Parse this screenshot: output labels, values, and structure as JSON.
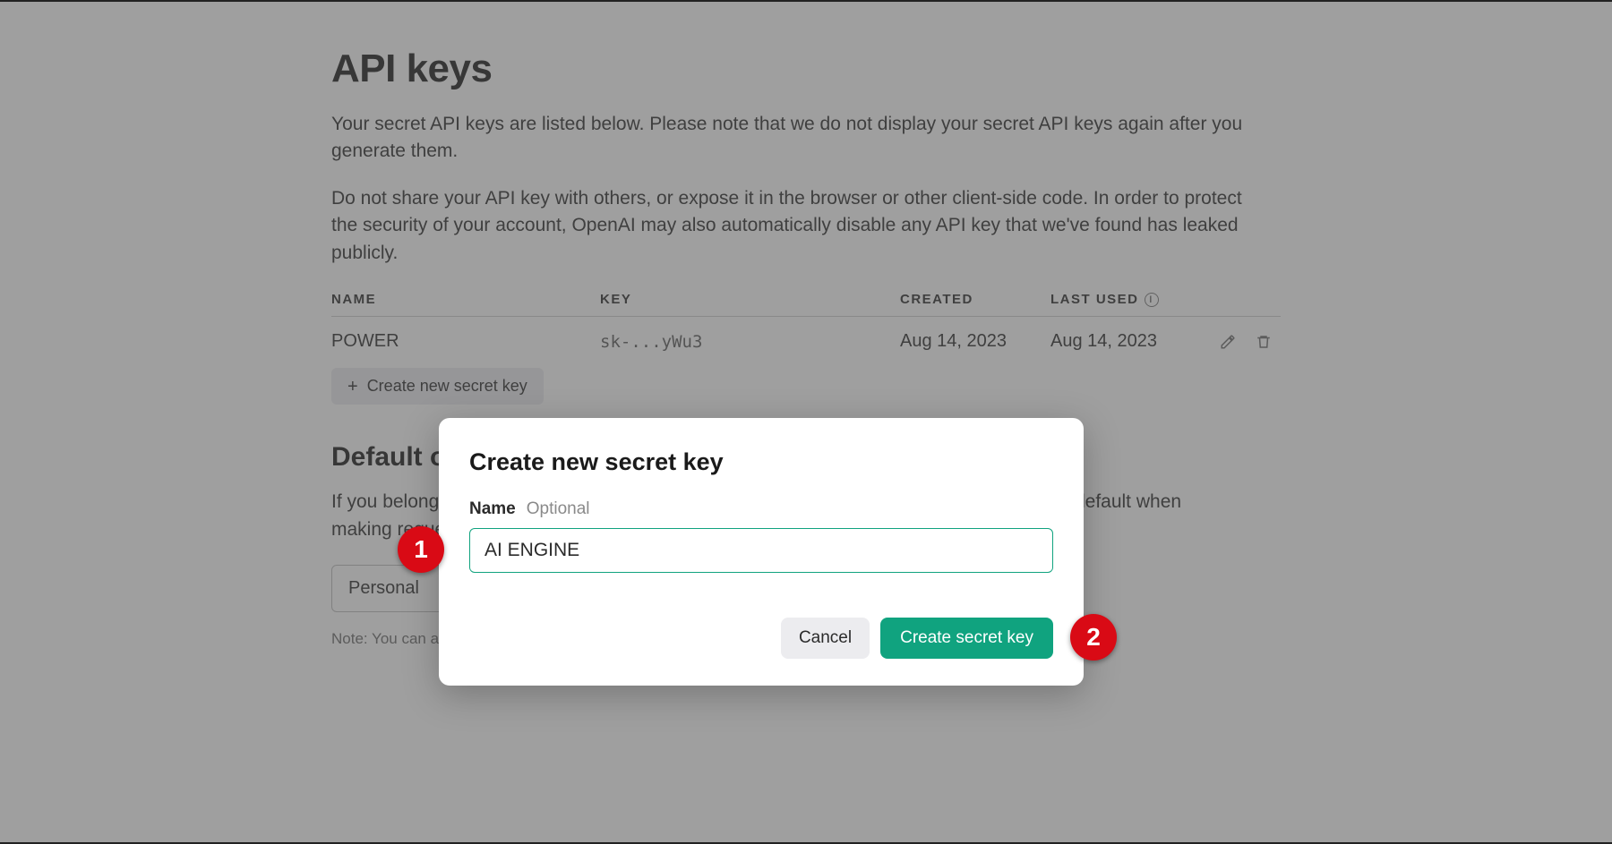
{
  "page": {
    "title": "API keys",
    "intro1": "Your secret API keys are listed below. Please note that we do not display your secret API keys again after you generate them.",
    "intro2": "Do not share your API key with others, or expose it in the browser or other client-side code. In order to protect the security of your account, OpenAI may also automatically disable any API key that we've found has leaked publicly."
  },
  "table": {
    "headers": {
      "name": "NAME",
      "key": "KEY",
      "created": "CREATED",
      "last_used": "LAST USED"
    },
    "rows": [
      {
        "name": "POWER",
        "key": "sk-...yWu3",
        "created": "Aug 14, 2023",
        "last_used": "Aug 14, 2023"
      }
    ]
  },
  "create_button": "Create new secret key",
  "default_org": {
    "title": "Default organization",
    "body_visible_prefix": "If you belon",
    "body_visible_suffix": " by default when making r",
    "body_full": "If you belong to multiple organizations, this setting controls which organization is used by default when making requests with the API keys above.",
    "select_value": "Personal",
    "note_visible": "Note: You can also spe",
    "note_full": "Note: You can also specify which organization to use for each API request. See Authentication to learn more."
  },
  "modal": {
    "title": "Create new secret key",
    "name_label": "Name",
    "name_optional": "Optional",
    "name_value": "AI ENGINE",
    "cancel": "Cancel",
    "create": "Create secret key"
  },
  "annotations": {
    "badge1": "1",
    "badge2": "2"
  },
  "icons": {
    "info": "i",
    "plus": "+",
    "chevron_down": "▾"
  }
}
